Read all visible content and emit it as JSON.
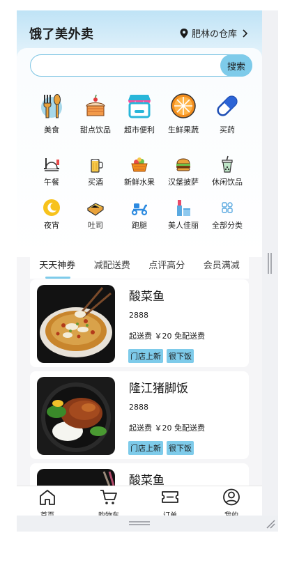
{
  "header": {
    "brand": "饿了美外卖",
    "location": "肥林の仓库"
  },
  "search": {
    "placeholder": "",
    "button_label": "搜索"
  },
  "main_categories": [
    {
      "label": "美食",
      "icon": "cutlery-icon"
    },
    {
      "label": "甜点饮品",
      "icon": "cake-icon"
    },
    {
      "label": "超市便利",
      "icon": "store-icon"
    },
    {
      "label": "生鲜果蔬",
      "icon": "orange-slice-icon"
    },
    {
      "label": "买药",
      "icon": "pill-icon"
    }
  ],
  "sub_categories": [
    {
      "label": "午餐",
      "icon": "lunch-tray-icon"
    },
    {
      "label": "买酒",
      "icon": "beer-icon"
    },
    {
      "label": "新鲜水果",
      "icon": "fruit-basket-icon"
    },
    {
      "label": "汉堡披萨",
      "icon": "burger-icon"
    },
    {
      "label": "休闲饮品",
      "icon": "drink-cup-icon"
    },
    {
      "label": "夜宵",
      "icon": "moon-icon"
    },
    {
      "label": "吐司",
      "icon": "toast-icon"
    },
    {
      "label": "跑腿",
      "icon": "scooter-icon"
    },
    {
      "label": "美人佳丽",
      "icon": "lipstick-icon"
    },
    {
      "label": "全部分类",
      "icon": "grid-icon"
    }
  ],
  "tabs": [
    "天天神券",
    "减配送费",
    "点评高分",
    "会员满减"
  ],
  "active_tab": 0,
  "stores": [
    {
      "name": "酸菜鱼",
      "sales": "2888",
      "fee": "起送费 ￥20 免配送费",
      "tags": [
        "门店上新",
        "很下饭"
      ],
      "image": "fish-soup-image"
    },
    {
      "name": "隆江猪脚饭",
      "sales": "2888",
      "fee": "起送费 ￥20 免配送费",
      "tags": [
        "门店上新",
        "很下饭"
      ],
      "image": "pork-rice-image"
    },
    {
      "name": "酸菜鱼",
      "sales": "",
      "fee": "",
      "tags": [],
      "image": "fish-soup-image"
    }
  ],
  "tabbar": [
    {
      "label": "首页",
      "icon": "home-icon"
    },
    {
      "label": "购物车",
      "icon": "cart-icon"
    },
    {
      "label": "订单",
      "icon": "ticket-icon"
    },
    {
      "label": "我的",
      "icon": "user-icon"
    }
  ],
  "colors": {
    "accent": "#7ecbea",
    "header_gradient_top": "#bfe3f6",
    "search_border": "#7cc4e3"
  }
}
